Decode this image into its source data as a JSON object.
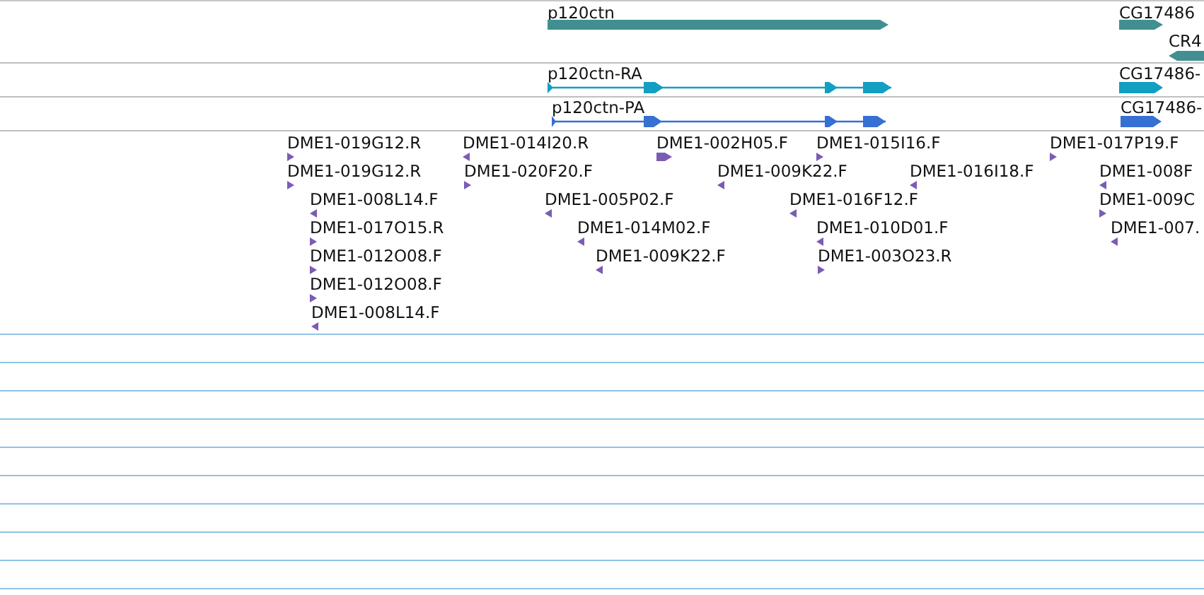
{
  "tracks": [
    {
      "kind": "gene",
      "features": [
        {
          "label": "p120ctn",
          "reverse": false
        },
        {
          "label": "CG17486",
          "reverse": false
        },
        {
          "label": "CR4",
          "reverse": true
        }
      ]
    },
    {
      "kind": "transcript",
      "features": [
        {
          "label": "p120ctn-RA",
          "reverse": false
        },
        {
          "label": "CG17486-",
          "reverse": false
        }
      ]
    },
    {
      "kind": "protein",
      "features": [
        {
          "label": "p120ctn-PA",
          "reverse": false
        },
        {
          "label": "CG17486-",
          "reverse": false
        }
      ]
    },
    {
      "kind": "est",
      "features": [
        {
          "label": "DME1-019G12.R",
          "reverse": false
        },
        {
          "label": "DME1-014I20.R",
          "reverse": true
        },
        {
          "label": "DME1-002H05.F",
          "reverse": false
        },
        {
          "label": "DME1-015I16.F",
          "reverse": false
        },
        {
          "label": "DME1-017P19.F",
          "reverse": false
        },
        {
          "label": "DME1-019G12.R",
          "reverse": false
        },
        {
          "label": "DME1-020F20.F",
          "reverse": false
        },
        {
          "label": "DME1-009K22.F",
          "reverse": true
        },
        {
          "label": "DME1-016I18.F",
          "reverse": true
        },
        {
          "label": "DME1-008F",
          "reverse": true
        },
        {
          "label": "DME1-008L14.F",
          "reverse": true
        },
        {
          "label": "DME1-005P02.F",
          "reverse": true
        },
        {
          "label": "DME1-016F12.F",
          "reverse": true
        },
        {
          "label": "DME1-009C",
          "reverse": false
        },
        {
          "label": "DME1-017O15.R",
          "reverse": false
        },
        {
          "label": "DME1-014M02.F",
          "reverse": true
        },
        {
          "label": "DME1-010D01.F",
          "reverse": true
        },
        {
          "label": "DME1-007.",
          "reverse": true
        },
        {
          "label": "DME1-012O08.F",
          "reverse": false
        },
        {
          "label": "DME1-009K22.F",
          "reverse": true
        },
        {
          "label": "DME1-003O23.R",
          "reverse": false
        },
        {
          "label": "DME1-012O08.F",
          "reverse": false
        },
        {
          "label": "DME1-008L14.F",
          "reverse": true
        }
      ]
    }
  ]
}
